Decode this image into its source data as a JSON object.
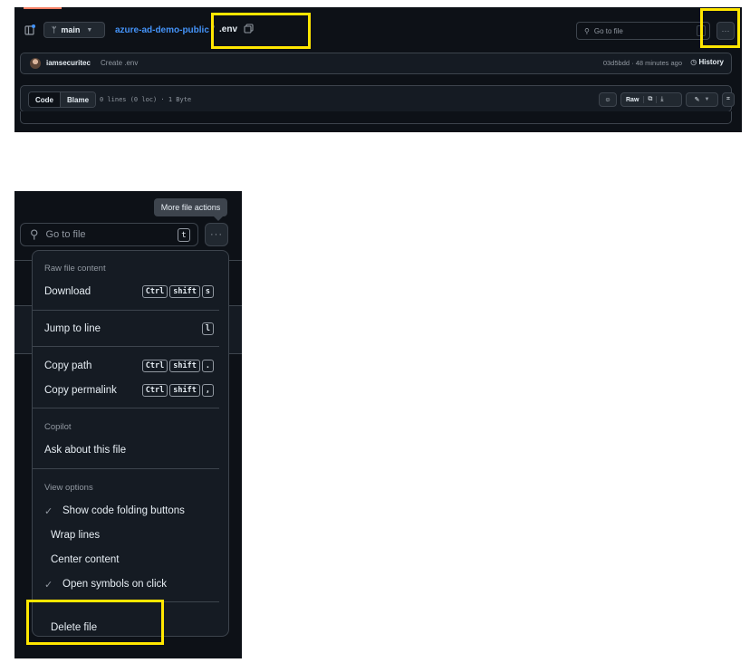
{
  "top": {
    "branch": "main",
    "repo": "azure-ad-demo-public",
    "separator": "/",
    "file": ".env",
    "search_placeholder": "Go to file",
    "more_label": "···",
    "commit": {
      "user": "iamsecuritec",
      "message": "Create .env",
      "hash_time": "03d5bdd · 48 minutes ago",
      "history": "History"
    },
    "code_tab": "Code",
    "blame_tab": "Blame",
    "file_meta": "0 lines (0 loc) · 1 Byte",
    "raw": "Raw"
  },
  "bottom": {
    "tooltip": "More file actions",
    "search_placeholder": "Go to file",
    "search_key": "t",
    "more_label": "···",
    "menu": {
      "raw_header": "Raw file content",
      "download": "Download",
      "download_keys": [
        "Ctrl",
        "shift",
        "s"
      ],
      "jump": "Jump to line",
      "jump_key": "l",
      "copy_path": "Copy path",
      "copy_path_keys": [
        "Ctrl",
        "shift",
        "."
      ],
      "copy_permalink": "Copy permalink",
      "copy_permalink_keys": [
        "Ctrl",
        "shift",
        ","
      ],
      "copilot_header": "Copilot",
      "ask": "Ask about this file",
      "view_header": "View options",
      "fold": "Show code folding buttons",
      "wrap": "Wrap lines",
      "center": "Center content",
      "symbols": "Open symbols on click",
      "delete": "Delete file",
      "check": "✓"
    }
  },
  "colors": {
    "bg": "#0d1117",
    "link": "#4493f8",
    "highlight": "#ffe600",
    "border": "#3d444d"
  }
}
